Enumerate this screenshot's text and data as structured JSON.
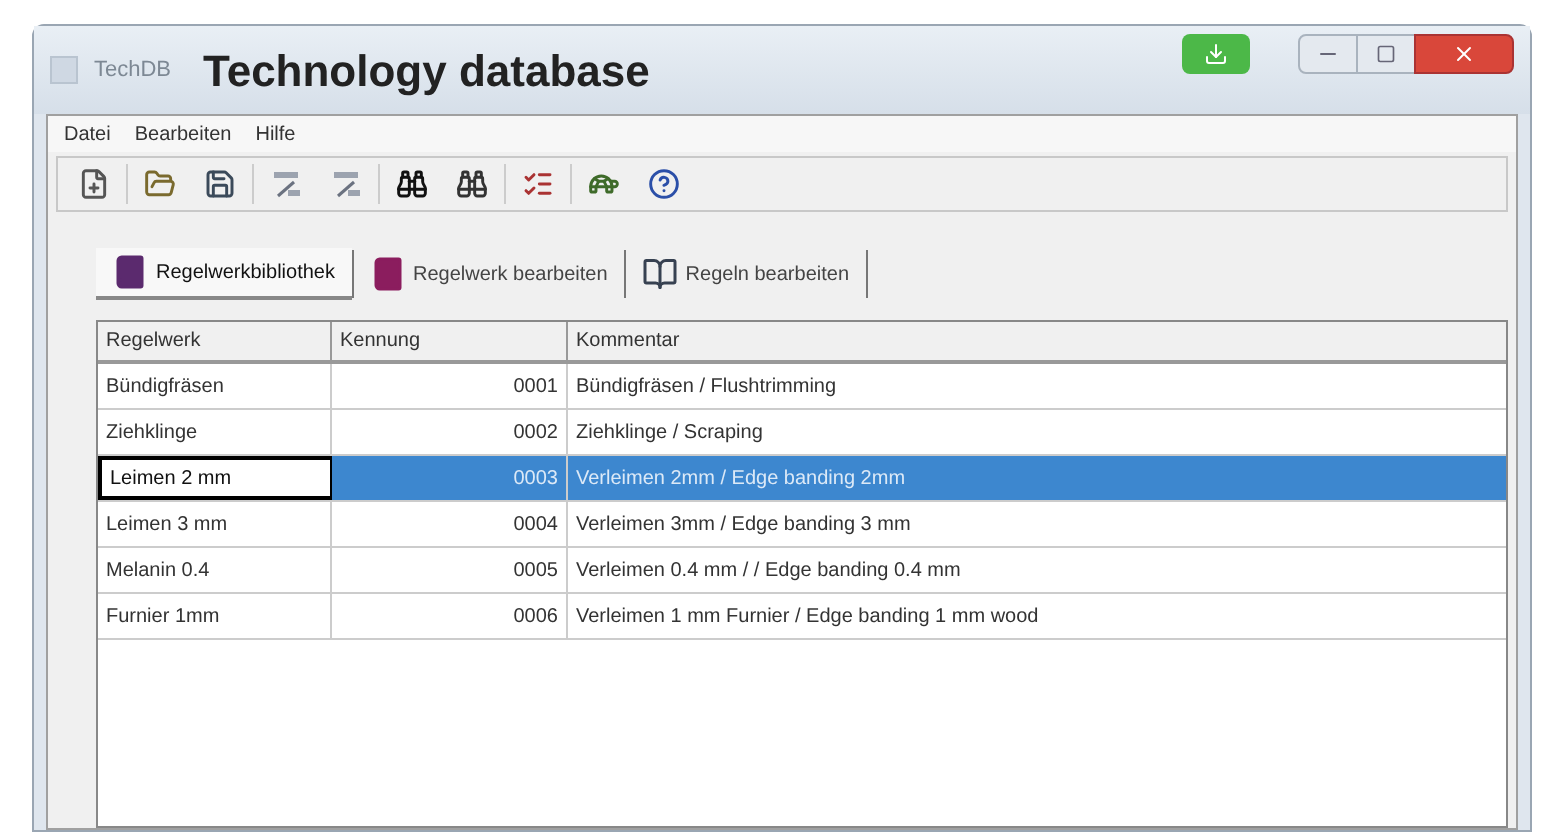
{
  "window": {
    "app_name": "TechDB",
    "caption": "Technology database"
  },
  "menu": [
    "Datei",
    "Bearbeiten",
    "Hilfe"
  ],
  "tabs": [
    {
      "label": "Regelwerkbibliothek",
      "selected": true
    },
    {
      "label": "Regelwerk bearbeiten",
      "selected": false
    },
    {
      "label": "Regeln bearbeiten",
      "selected": false
    }
  ],
  "table": {
    "columns": [
      "Regelwerk",
      "Kennung",
      "Kommentar"
    ],
    "rows": [
      {
        "cells": [
          "Bündigfräsen",
          "0001",
          "Bündigfräsen / Flushtrimming"
        ],
        "selected": false
      },
      {
        "cells": [
          "Ziehklinge",
          "0002",
          "Ziehklinge / Scraping"
        ],
        "selected": false
      },
      {
        "cells": [
          "Leimen 2 mm",
          "0003",
          "Verleimen 2mm  / Edge banding 2mm"
        ],
        "selected": true
      },
      {
        "cells": [
          "Leimen 3 mm",
          "0004",
          "Verleimen 3mm  / Edge banding 3 mm"
        ],
        "selected": false
      },
      {
        "cells": [
          "Melanin 0.4",
          "0005",
          "Verleimen 0.4 mm / / Edge banding 0.4 mm"
        ],
        "selected": false
      },
      {
        "cells": [
          "Furnier 1mm",
          "0006",
          "Verleimen 1 mm Furnier  / Edge banding 1 mm wood"
        ],
        "selected": false
      }
    ]
  }
}
